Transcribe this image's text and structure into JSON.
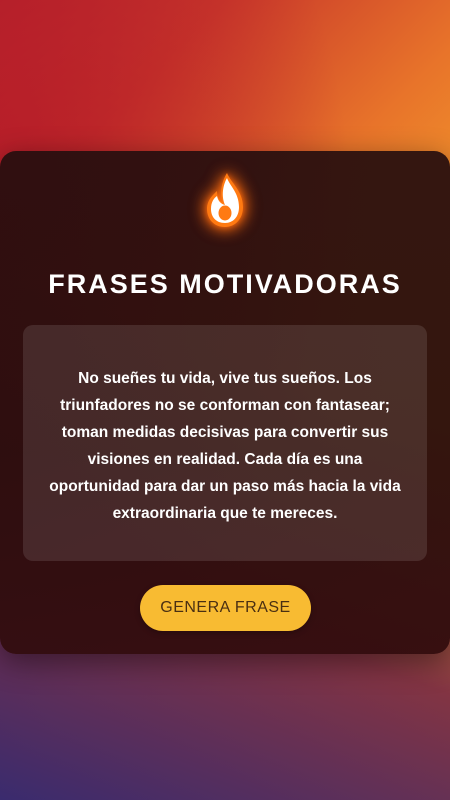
{
  "app": {
    "title": "FRASES MOTIVADORAS",
    "icon": "flame-icon"
  },
  "quote": {
    "text": "No sueñes tu vida, vive tus sueños. Los triunfadores no se conforman con fantasear; toman medidas decisivas para convertir sus visiones en realidad. Cada día es una oportunidad para dar un paso más hacia la vida extraordinaria que te mereces."
  },
  "actions": {
    "generate_label": "GENERA FRASE"
  },
  "colors": {
    "accent": "#f8bb32",
    "flame": "#ff7a12",
    "card_bg": "#260e0e"
  }
}
